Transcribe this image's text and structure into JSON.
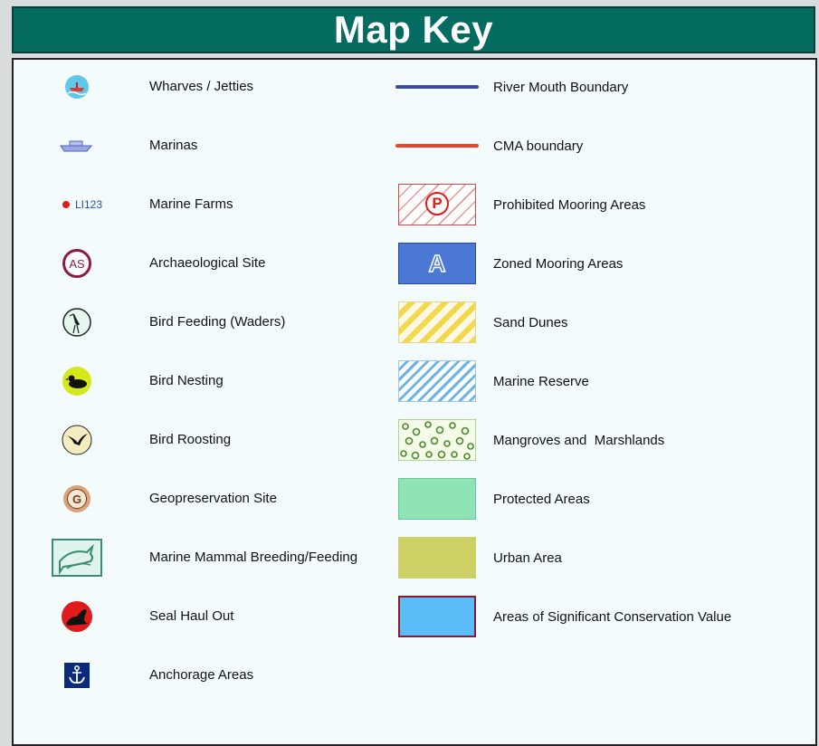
{
  "title": "Map Key",
  "left_items": [
    {
      "label": "Wharves / Jetties",
      "icon": "wharf-icon"
    },
    {
      "label": "Marinas",
      "icon": "boat-icon"
    },
    {
      "label": "Marine Farms",
      "icon": "marine-farm-dot-icon",
      "code": "LI123"
    },
    {
      "label": "Archaeological Site",
      "icon": "archaeological-site-icon",
      "code": "AS"
    },
    {
      "label": "Bird Feeding (Waders)",
      "icon": "wading-bird-icon"
    },
    {
      "label": "Bird Nesting",
      "icon": "nesting-duck-icon"
    },
    {
      "label": "Bird Roosting",
      "icon": "roosting-bird-icon"
    },
    {
      "label": "Geopreservation Site",
      "icon": "geopreservation-icon",
      "code": "G"
    },
    {
      "label": "Marine Mammal Breeding/Feeding",
      "icon": "dolphin-icon"
    },
    {
      "label": "Seal Haul Out",
      "icon": "seal-icon"
    },
    {
      "label": "Anchorage Areas",
      "icon": "anchor-icon"
    }
  ],
  "right_items": [
    {
      "label": "River Mouth Boundary",
      "symbol": "line",
      "color": "#3c4c96"
    },
    {
      "label": "CMA boundary",
      "symbol": "line",
      "color": "#e8452f"
    },
    {
      "label": "Prohibited Mooring Areas",
      "symbol": "hatch-red-p",
      "code": "P",
      "color": "#e23a3a"
    },
    {
      "label": "Zoned Mooring Areas",
      "symbol": "blue-a",
      "code": "A",
      "color": "#4a78d4"
    },
    {
      "label": "Sand Dunes",
      "symbol": "hatch-yellow",
      "color": "#f2d84a"
    },
    {
      "label": "Marine Reserve",
      "symbol": "hatch-blue",
      "color": "#6ab4e8"
    },
    {
      "label": "Mangroves and  Marshlands",
      "symbol": "mangrove",
      "color": "#5a9a3a"
    },
    {
      "label": "Protected Areas",
      "symbol": "fill",
      "color": "#8ee4b4"
    },
    {
      "label": "Urban Area",
      "symbol": "fill",
      "color": "#cdd065"
    },
    {
      "label": "Areas of Significant Conservation Value",
      "symbol": "fill-border",
      "color": "#5cbcf8",
      "border": "#8a1a2a"
    }
  ]
}
